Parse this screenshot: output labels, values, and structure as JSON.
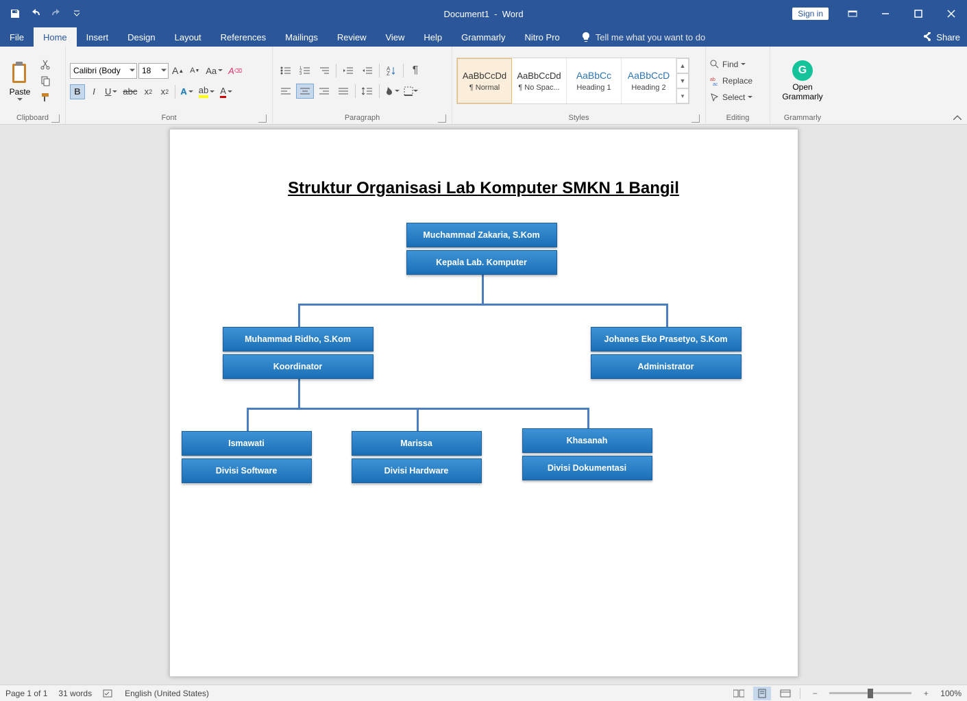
{
  "titlebar": {
    "document": "Document1",
    "app": "Word",
    "signin": "Sign in"
  },
  "tabs": [
    "File",
    "Home",
    "Insert",
    "Design",
    "Layout",
    "References",
    "Mailings",
    "Review",
    "View",
    "Help",
    "Grammarly",
    "Nitro Pro"
  ],
  "active_tab": "Home",
  "tellme_placeholder": "Tell me what you want to do",
  "share": "Share",
  "ribbon": {
    "clipboard": {
      "label": "Clipboard",
      "paste": "Paste"
    },
    "font": {
      "label": "Font",
      "name": "Calibri (Body",
      "size": "18"
    },
    "paragraph": {
      "label": "Paragraph"
    },
    "styles": {
      "label": "Styles",
      "items": [
        {
          "preview": "AaBbCcDd",
          "name": "¶ Normal",
          "sel": true,
          "h": false
        },
        {
          "preview": "AaBbCcDd",
          "name": "¶ No Spac...",
          "sel": false,
          "h": false
        },
        {
          "preview": "AaBbCc",
          "name": "Heading 1",
          "sel": false,
          "h": true
        },
        {
          "preview": "AaBbCcD",
          "name": "Heading 2",
          "sel": false,
          "h": true
        }
      ]
    },
    "editing": {
      "label": "Editing",
      "find": "Find",
      "replace": "Replace",
      "select": "Select"
    },
    "grammarly": {
      "label": "Grammarly",
      "open": "Open\nGrammarly"
    }
  },
  "document": {
    "title": "Struktur Organisasi Lab Komputer SMKN 1 Bangil",
    "org": {
      "top": {
        "name": "Muchammad Zakaria, S.Kom",
        "role": "Kepala Lab. Komputer"
      },
      "mid": [
        {
          "name": "Muhammad Ridho, S.Kom",
          "role": "Koordinator"
        },
        {
          "name": "Johanes Eko Prasetyo, S.Kom",
          "role": "Administrator"
        }
      ],
      "bottom": [
        {
          "name": "Ismawati",
          "role": "Divisi Software"
        },
        {
          "name": "Marissa",
          "role": "Divisi Hardware"
        },
        {
          "name": "Khasanah",
          "role": "Divisi Dokumentasi"
        }
      ]
    }
  },
  "status": {
    "page": "Page 1 of 1",
    "words": "31 words",
    "lang": "English (United States)",
    "zoom": "100%"
  }
}
